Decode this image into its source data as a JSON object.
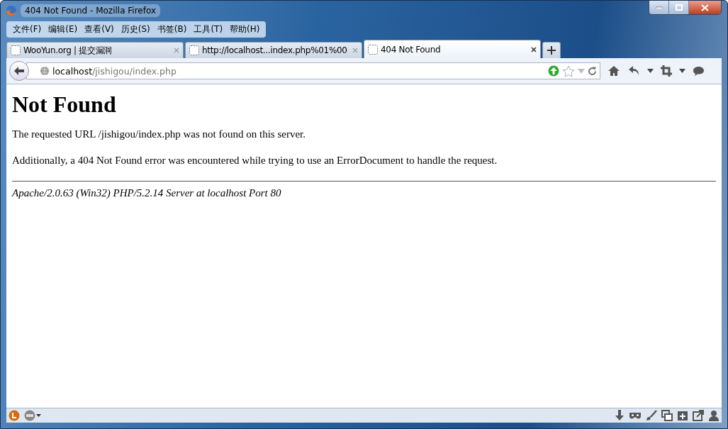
{
  "window": {
    "title": "404 Not Found - Mozilla Firefox"
  },
  "menu": [
    "文件(F)",
    "编辑(E)",
    "查看(V)",
    "历史(S)",
    "书签(B)",
    "工具(T)",
    "帮助(H)"
  ],
  "tabs": [
    {
      "label": "WooYun.org | 提交漏洞",
      "selected": false
    },
    {
      "label": "http://localhost...index.php%01%00",
      "selected": false
    },
    {
      "label": "404 Not Found",
      "selected": true
    }
  ],
  "address": {
    "host": "localhost",
    "path": "/jishigou/index.php"
  },
  "page": {
    "heading": "Not Found",
    "paragraphs": [
      "The requested URL /jishigou/index.php was not found on this server.",
      "Additionally, a 404 Not Found error was encountered while trying to use an ErrorDocument to handle the request."
    ],
    "signature": "Apache/2.0.63 (Win32) PHP/5.2.14 Server at localhost Port 80"
  }
}
